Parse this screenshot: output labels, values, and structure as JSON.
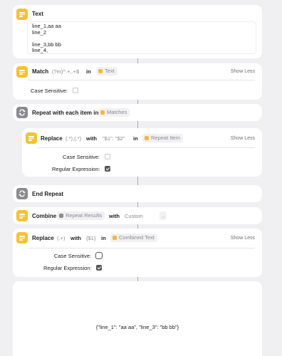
{
  "text_action": {
    "title": "Text",
    "lines": [
      "line_1,aa aa",
      "line_2",
      "",
      "line_3,bb bb",
      "line_4,"
    ]
  },
  "match_action": {
    "title": "Match",
    "pattern": "(?m)^.+,.+$",
    "in_label": "in",
    "input_token": "Text",
    "show_less": "Show Less",
    "case_sensitive_label": "Case Sensitive:",
    "case_sensitive": false
  },
  "repeat_action": {
    "title": "Repeat with each item in",
    "token": "Matches"
  },
  "replace_inner": {
    "title": "Replace",
    "pattern": "(.*),(.*)",
    "with_label": "with",
    "replacement": "\"$1\": \"$2\"",
    "in_label": "in",
    "token": "Repeat Item",
    "show_less": "Show Less",
    "case_sensitive_label": "Case Sensitive:",
    "case_sensitive": false,
    "regex_label": "Regular Expression:",
    "regex": true
  },
  "end_repeat": {
    "title": "End Repeat"
  },
  "combine_action": {
    "title": "Combine",
    "token": "Repeat Results",
    "with_label": "with",
    "separator_mode": "Custom",
    "separator": ","
  },
  "replace_outer": {
    "title": "Replace",
    "pattern": "(.+)",
    "with_label": "with",
    "replacement": "{$1}",
    "in_label": "in",
    "token": "Combined Text",
    "show_less": "Show Less",
    "case_sensitive_label": "Case Sensitive:",
    "case_sensitive": false,
    "regex_label": "Regular Expression:",
    "regex": true
  },
  "result": {
    "output": "{\"line_1\": \"aa aa\", \"line_3\": \"bb bb\"}"
  },
  "colors": {
    "background": "#f0f0f3",
    "card": "#ffffff",
    "text_icon": "#f5c233",
    "repeat_icon": "#8a8a8f",
    "token_bg": "#f1f1f3"
  }
}
